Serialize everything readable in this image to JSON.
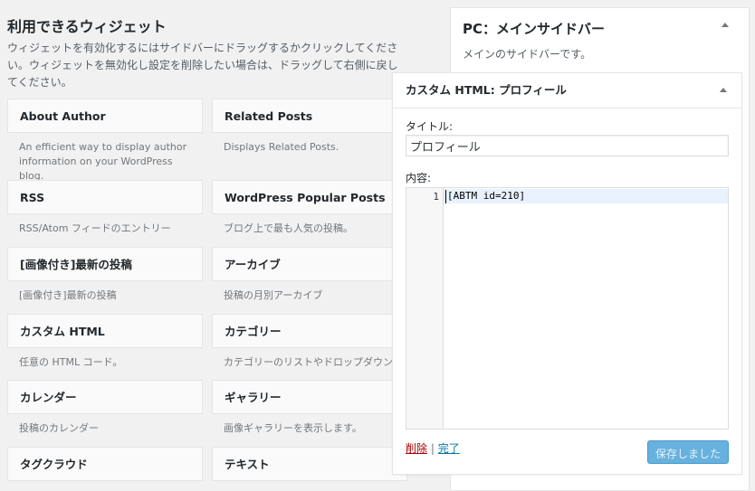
{
  "available": {
    "title": "利用できるウィジェット",
    "description": "ウィジェットを有効化するにはサイドバーにドラッグするかクリックしてください。ウィジェットを無効化し設定を削除したい場合は、ドラッグして右側に戻してください。",
    "widgets": [
      {
        "name": "About Author",
        "description": "An efficient way to display author information on your WordPress blog."
      },
      {
        "name": "Related Posts",
        "description": "Displays Related Posts."
      },
      {
        "name": "RSS",
        "description": "RSS/Atom フィードのエントリー"
      },
      {
        "name": "WordPress Popular Posts",
        "description": "ブログ上で最も人気の投稿。"
      },
      {
        "name": "[画像付き]最新の投稿",
        "description": "[画像付き]最新の投稿"
      },
      {
        "name": "アーカイブ",
        "description": "投稿の月別アーカイブ"
      },
      {
        "name": "カスタム HTML",
        "description": "任意の HTML コード。"
      },
      {
        "name": "カテゴリー",
        "description": "カテゴリーのリストやドロップダウン"
      },
      {
        "name": "カレンダー",
        "description": "投稿のカレンダー"
      },
      {
        "name": "ギャラリー",
        "description": "画像ギャラリーを表示します。"
      },
      {
        "name": "タグクラウド",
        "description": ""
      },
      {
        "name": "テキスト",
        "description": ""
      }
    ]
  },
  "sidebar": {
    "title": "PC：メインサイドバー",
    "description": "メインのサイドバーです。"
  },
  "expanded_widget": {
    "title": "カスタム HTML: プロフィール",
    "title_label": "タイトル:",
    "title_value": "プロフィール",
    "content_label": "内容:",
    "line_number": "1",
    "code": "[ABTM id=210]",
    "delete_label": "削除",
    "separator": "|",
    "done_label": "完了",
    "save_label": "保存しました"
  },
  "colors": {
    "background": "#f1f1f1",
    "delete_link": "#aa0000",
    "done_link": "#0073aa",
    "save_button": "#66b1dd"
  }
}
